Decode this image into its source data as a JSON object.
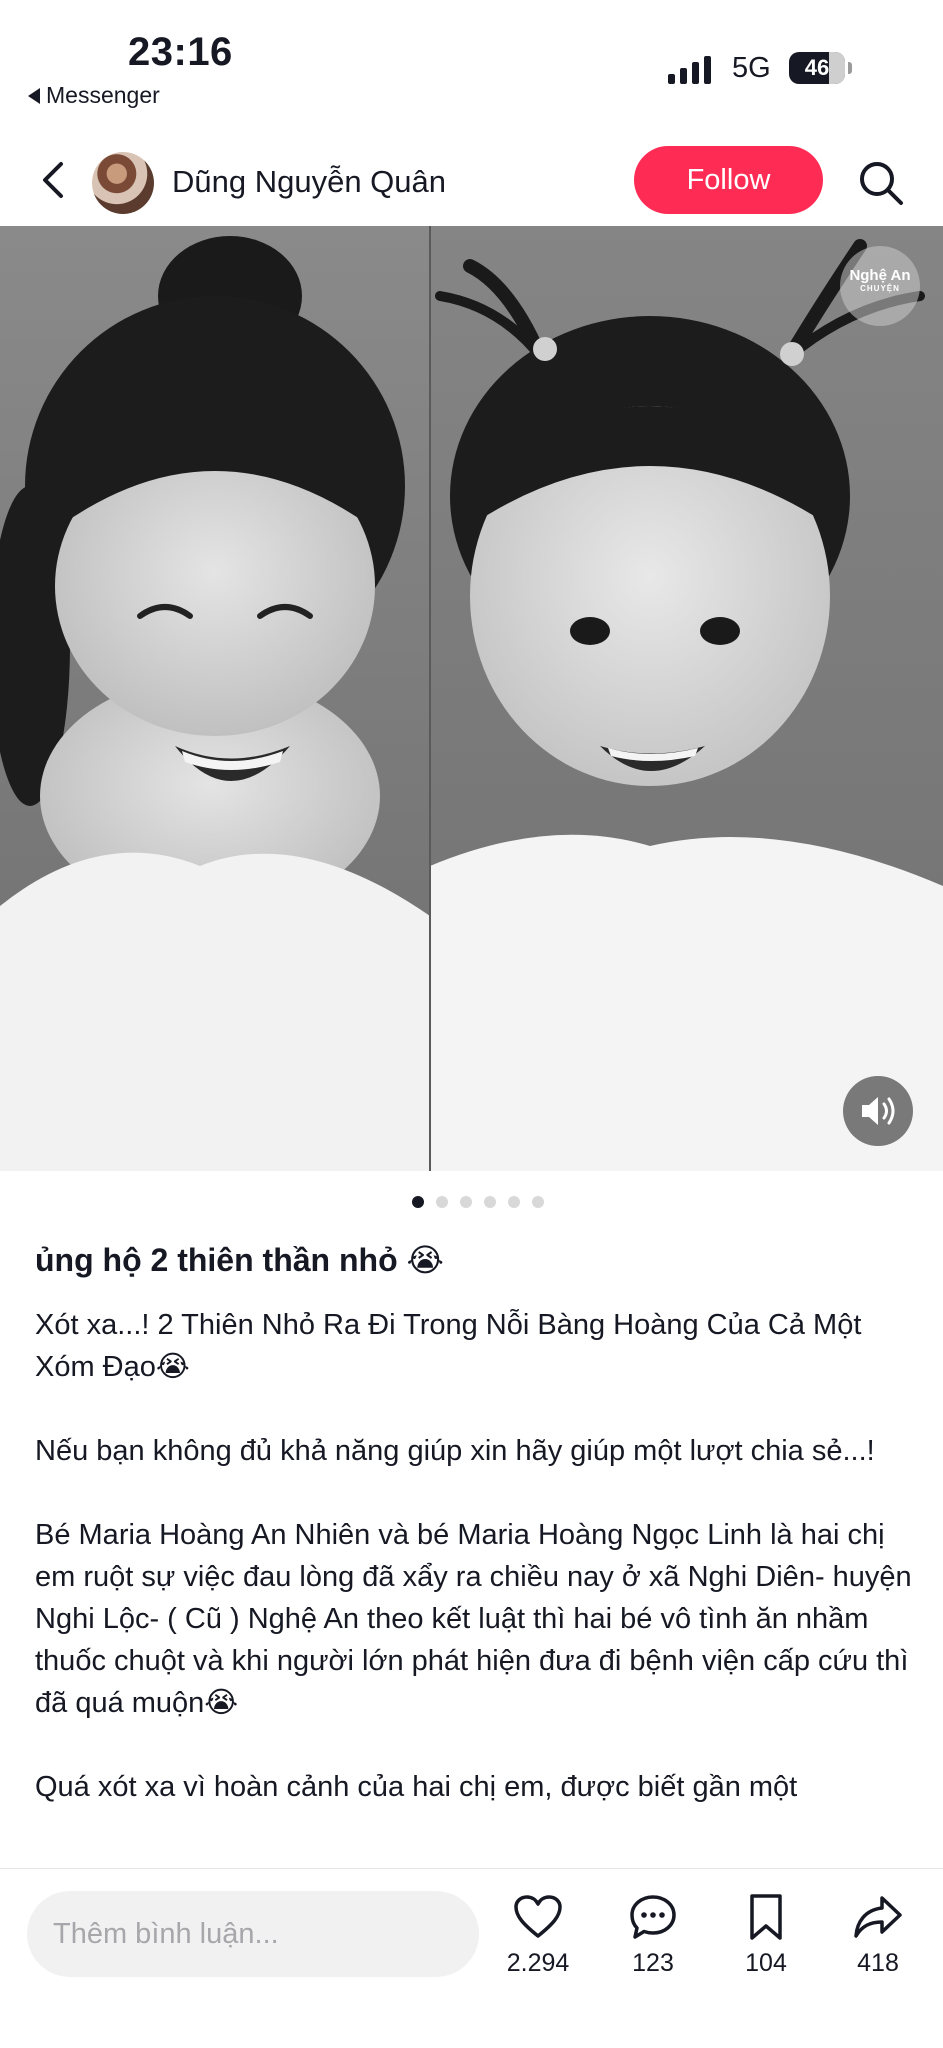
{
  "status_bar": {
    "time": "23:16",
    "back_app": "Messenger",
    "network": "5G",
    "battery": "46"
  },
  "header": {
    "username": "Dũng Nguyễn Quân",
    "follow_label": "Follow",
    "icons": [
      "chevron-left-icon",
      "search-icon"
    ]
  },
  "media": {
    "watermark_line1": "Nghệ An",
    "watermark_line2": "CHUYỆN",
    "sound_icon": "speaker-icon",
    "slide_count": 6,
    "active_slide": 1
  },
  "post": {
    "title": "ủng hộ 2 thiên thần nhỏ 😭",
    "paragraphs": [
      "Xót xa...! 2 Thiên Nhỏ Ra Đi Trong Nỗi Bàng Hoàng Của Cả Một Xóm Đạo😭",
      "Nếu bạn không đủ khả năng giúp xin hãy giúp một lượt chia sẻ...!",
      "Bé Maria Hoàng An Nhiên và bé Maria Hoàng Ngọc Linh là hai chị em ruột sự việc đau lòng đã xẩy ra chiều nay ở xã Nghi Diên- huyện Nghi Lộc- ( Cũ ) Nghệ An theo kết luật thì hai bé vô tình ăn nhầm thuốc chuột và khi người lớn phát hiện đưa đi bệnh viện cấp cứu thì đã quá muộn😭",
      "Quá xót xa vì hoàn cảnh của hai chị em, được biết gần một"
    ]
  },
  "bottom_bar": {
    "comment_placeholder": "Thêm bình luận...",
    "likes": "2.294",
    "comments": "123",
    "saves": "104",
    "shares": "418"
  },
  "colors": {
    "accent": "#fe2c55",
    "text": "#161823",
    "input_bg": "#f1f1f2"
  }
}
